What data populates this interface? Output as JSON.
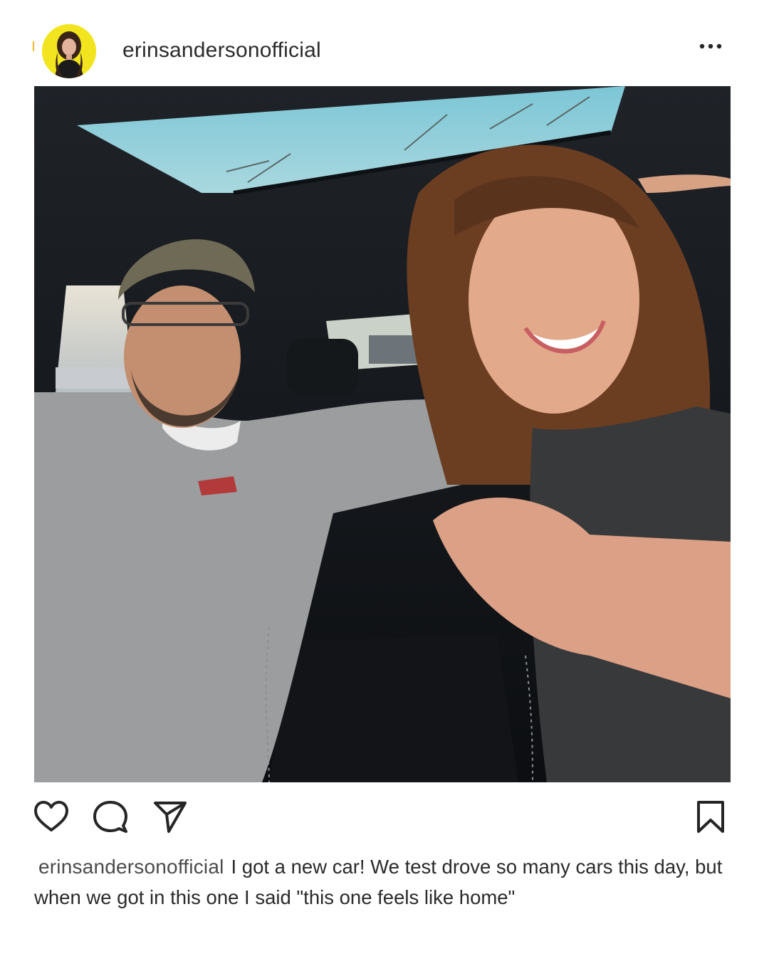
{
  "post": {
    "username": "erinsandersonofficial",
    "more_icon": "more-horizontal-icon",
    "actions": {
      "like_icon": "heart-icon",
      "comment_icon": "comment-bubble-icon",
      "share_icon": "send-arrow-icon",
      "save_icon": "bookmark-icon"
    },
    "caption": {
      "username": "erinsandersonofficial",
      "text": "I got a new car! We test drove so many cars this day, but when we got in this one I said \"this one feels like home\""
    },
    "colors": {
      "avatar_ring": "#f2e51f",
      "text": "#262626",
      "icon": "#262626"
    }
  }
}
